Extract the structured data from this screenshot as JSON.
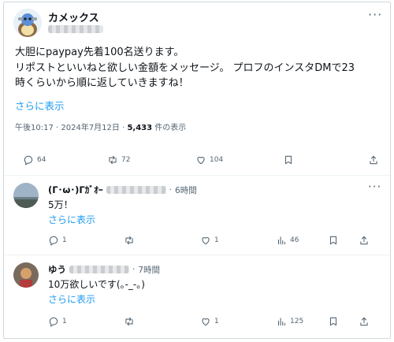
{
  "tweet": {
    "display_name": "カメックス",
    "body_lines": [
      "大胆にpaypay先着100名送ります。",
      "リポストといいねと欲しい金額をメッセージ。 プロフのインスタDMで23",
      "時くらいから順に返していきますね！"
    ],
    "show_more": "さらに表示",
    "time": "午後10:17",
    "date": "2024年7月12日",
    "views": "5,433",
    "views_suffix": "件の表示",
    "replies": "64",
    "reposts": "72",
    "likes": "104"
  },
  "replies": [
    {
      "name": "(Γ･ω･)Γｶﾞｵｰ",
      "time": "6時間",
      "text": "5万！",
      "show_more": "さらに表示",
      "reply_count": "1",
      "like_count": "1",
      "view_count": "46"
    },
    {
      "name": "ゆう",
      "time": "7時間",
      "text": "10万欲しいです(｡-_-｡)",
      "show_more": "さらに表示",
      "reply_count": "1",
      "like_count": "1",
      "view_count": "125"
    }
  ],
  "icons": {
    "reply": "speech-bubble-icon",
    "repost": "repost-arrows-icon",
    "like": "heart-icon",
    "views": "bar-chart-icon",
    "bookmark": "bookmark-icon",
    "share": "share-icon",
    "more": "more-dots-icon"
  },
  "colors": {
    "link": "#1d9bf0",
    "muted": "#536471",
    "text": "#0f1419"
  }
}
